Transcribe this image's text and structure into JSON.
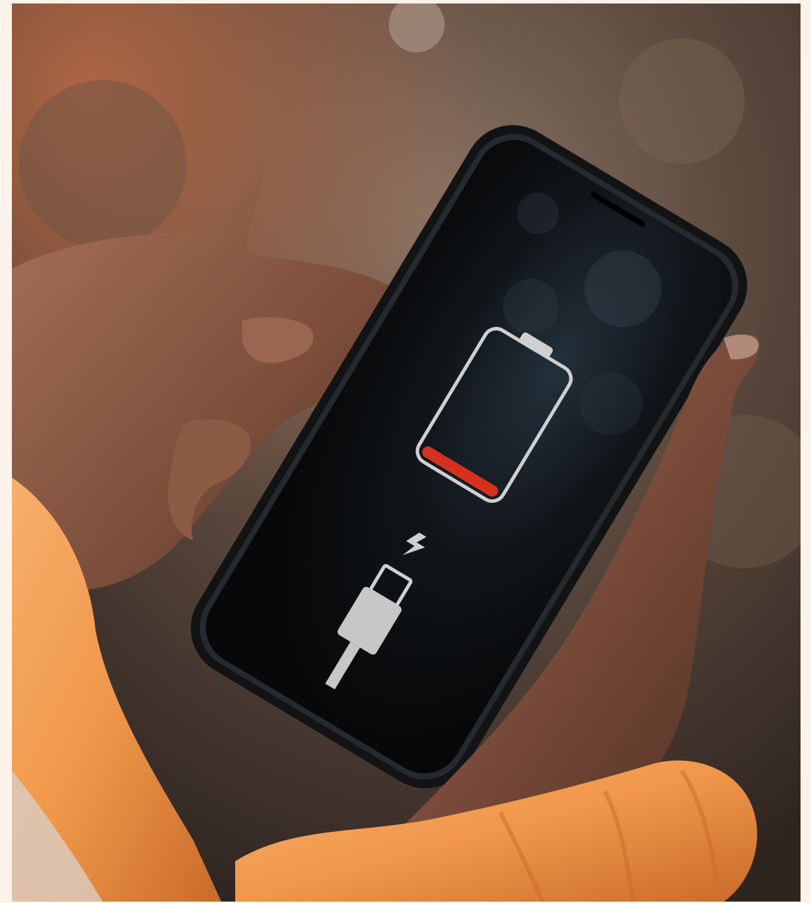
{
  "photo": {
    "subject": "phone-low-battery",
    "icons": [
      "battery-icon",
      "lightning-bolt-icon",
      "charging-cable-icon"
    ],
    "battery_level": 0.08,
    "colors": {
      "page_background": "#fbf3ea",
      "battery_fill": "#d8301f",
      "screen_icons": "#cfcfcf",
      "phone_screen": "#0b0c0e",
      "sleeve": "#f29a4a"
    }
  }
}
